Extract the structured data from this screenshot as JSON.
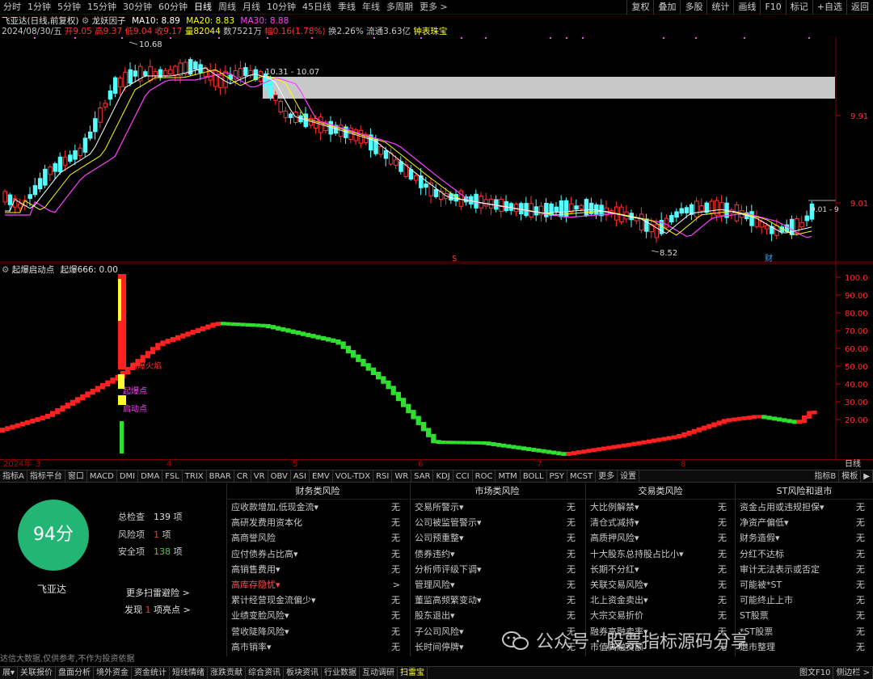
{
  "topbar": {
    "periods": [
      "分时",
      "1分钟",
      "5分钟",
      "15分钟",
      "30分钟",
      "60分钟",
      "日线",
      "周线",
      "月线",
      "10分钟",
      "45日线",
      "季线",
      "年线",
      "多周期",
      "更多 >"
    ],
    "active": "日线",
    "right_buttons": [
      "复权",
      "叠加",
      "多股",
      "统计",
      "画线",
      "F10",
      "标记",
      "+自选",
      "返回"
    ]
  },
  "info": {
    "title": "飞亚达(日线,前复权)",
    "indicator": "龙妖因子",
    "ma10": "MA10: 8.89",
    "ma20": "MA20: 8.83",
    "ma30": "MA30: 8.88",
    "date": "2024/08/30/五",
    "open": "开9.05",
    "high": "高9.37",
    "low": "低9.04",
    "close": "收9.17",
    "volume": "量82044",
    "amount": "数7521万",
    "change": "幅0.16(1.78%)",
    "turnover": "换2.26%",
    "float": "流通3.63亿",
    "tool": "钟表珠宝"
  },
  "main_chart": {
    "price_labels": [
      "9.91",
      "9.01"
    ],
    "annotations": {
      "high": "10.68",
      "zone": "10.31 - 10.07",
      "low": "8.52",
      "current": "9.01 - 9",
      "s_mark": "S",
      "cai_mark": "财"
    },
    "colors": {
      "up": "#ff3232",
      "down": "#54ffff",
      "ma10": "#ffffff",
      "ma20": "#ffff00",
      "ma30": "#ff40ff",
      "zone": "#c8c8c8"
    }
  },
  "sub_chart": {
    "title": "起爆启动点",
    "value": "起爆666: 0.00",
    "y_ticks": [
      "100.0",
      "90.00",
      "80.00",
      "70.00",
      "60.00",
      "50.00",
      "40.00",
      "30.00",
      "20.00"
    ],
    "labels": {
      "fire": "启爆火焰",
      "burst": "起爆点",
      "start": "启动点"
    }
  },
  "date_axis": [
    "2024年",
    "3",
    "4",
    "5",
    "6",
    "7",
    "8",
    "日线"
  ],
  "indicator_tabs": [
    "指标A",
    "指标平台",
    "窗口",
    "MACD",
    "DMI",
    "DMA",
    "FSL",
    "TRIX",
    "BRAR",
    "CR",
    "VR",
    "OBV",
    "ASI",
    "EMV",
    "VOL-TDX",
    "RSI",
    "WR",
    "SAR",
    "KDJ",
    "CCI",
    "ROC",
    "MTM",
    "BOLL",
    "PSY",
    "MCST",
    "更多",
    "设置"
  ],
  "indicator_tabs_right": [
    "指标B",
    "模板",
    "▶"
  ],
  "panel": {
    "score": "94分",
    "name": "飞亚达",
    "total_label": "总检查",
    "total": "139",
    "total_unit": "项",
    "risk_label": "风险项",
    "risk": "1",
    "risk_unit": "项",
    "safe_label": "安全项",
    "safe": "138",
    "safe_unit": "项",
    "more": "更多扫雷避险 >",
    "found_pre": "发现",
    "found": "1",
    "found_post": "项亮点 >",
    "disclaimer": "达信大数据,仅供参考,不作为投资依据",
    "columns": [
      {
        "title": "财务类风险",
        "rows": [
          {
            "label": "应收款增加,低现金流▾",
            "val": "无"
          },
          {
            "label": "高研发费用资本化",
            "val": "无"
          },
          {
            "label": "高商誉风险",
            "val": "无"
          },
          {
            "label": "应付债券占比高▾",
            "val": "无"
          },
          {
            "label": "高销售费用▾",
            "val": "无"
          },
          {
            "label": "高库存隐忧▾",
            "val": ">",
            "warn": true
          },
          {
            "label": "累计经营现金流偏少▾",
            "val": "无"
          },
          {
            "label": "业绩变脸风险▾",
            "val": "无"
          },
          {
            "label": "营收陡降风险▾",
            "val": "无"
          },
          {
            "label": "高市销率▾",
            "val": "无"
          }
        ]
      },
      {
        "title": "市场类风险",
        "rows": [
          {
            "label": "交易所警示▾",
            "val": "无"
          },
          {
            "label": "公司被监管警示▾",
            "val": "无"
          },
          {
            "label": "公司预重整▾",
            "val": "无"
          },
          {
            "label": "债券违约▾",
            "val": "无"
          },
          {
            "label": "分析师评级下调▾",
            "val": "无"
          },
          {
            "label": "管理风险▾",
            "val": "无"
          },
          {
            "label": "董监高频繁变动▾",
            "val": "无"
          },
          {
            "label": "股东退出▾",
            "val": "无"
          },
          {
            "label": "子公司风险▾",
            "val": "无"
          },
          {
            "label": "长时间停牌▾",
            "val": "无"
          }
        ]
      },
      {
        "title": "交易类风险",
        "rows": [
          {
            "label": "大比例解禁▾",
            "val": "无"
          },
          {
            "label": "清仓式减持▾",
            "val": "无"
          },
          {
            "label": "高质押风险▾",
            "val": "无"
          },
          {
            "label": "十大股东总持股占比小▾",
            "val": "无"
          },
          {
            "label": "长期不分红▾",
            "val": "无"
          },
          {
            "label": "关联交易风险▾",
            "val": "无"
          },
          {
            "label": "北上资金卖出▾",
            "val": "无"
          },
          {
            "label": "大宗交易折价",
            "val": "无"
          },
          {
            "label": "融券高融卖率▾",
            "val": "无"
          },
          {
            "label": "市值高融资额",
            "val": "无"
          }
        ]
      },
      {
        "title": "ST风险和退市",
        "rows": [
          {
            "label": "资金占用或违规担保▾",
            "val": "无"
          },
          {
            "label": "净资产偏低▾",
            "val": "无"
          },
          {
            "label": "财务造假▾",
            "val": "无"
          },
          {
            "label": "分红不达标",
            "val": "无"
          },
          {
            "label": "审计无法表示或否定",
            "val": "无"
          },
          {
            "label": "可能被*ST",
            "val": "无"
          },
          {
            "label": "可能终止上市",
            "val": "无"
          },
          {
            "label": "ST股票",
            "val": "无"
          },
          {
            "label": "*ST股票",
            "val": "无"
          },
          {
            "label": "退市整理",
            "val": "无"
          }
        ]
      }
    ]
  },
  "bottombar": [
    "展▾",
    "关联报价",
    "盘面分析",
    "境外资金",
    "资金统计",
    "短线情绪",
    "涨跌贡献",
    "综合资讯",
    "板块资讯",
    "行业数据",
    "互动调研",
    "扫雷宝"
  ],
  "bottombar_active": "扫雷宝",
  "bottombar_right": [
    "图文F10",
    "侧边栏 >"
  ],
  "watermark": "公众号 · 股票指标源码分享"
}
